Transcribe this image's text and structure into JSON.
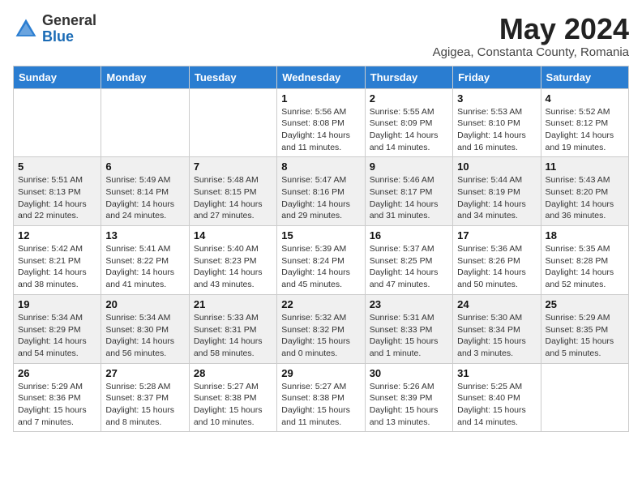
{
  "header": {
    "logo_general": "General",
    "logo_blue": "Blue",
    "month_title": "May 2024",
    "subtitle": "Agigea, Constanta County, Romania"
  },
  "weekdays": [
    "Sunday",
    "Monday",
    "Tuesday",
    "Wednesday",
    "Thursday",
    "Friday",
    "Saturday"
  ],
  "weeks": [
    [
      {
        "day": "",
        "sunrise": "",
        "sunset": "",
        "daylight": ""
      },
      {
        "day": "",
        "sunrise": "",
        "sunset": "",
        "daylight": ""
      },
      {
        "day": "",
        "sunrise": "",
        "sunset": "",
        "daylight": ""
      },
      {
        "day": "1",
        "sunrise": "Sunrise: 5:56 AM",
        "sunset": "Sunset: 8:08 PM",
        "daylight": "Daylight: 14 hours and 11 minutes."
      },
      {
        "day": "2",
        "sunrise": "Sunrise: 5:55 AM",
        "sunset": "Sunset: 8:09 PM",
        "daylight": "Daylight: 14 hours and 14 minutes."
      },
      {
        "day": "3",
        "sunrise": "Sunrise: 5:53 AM",
        "sunset": "Sunset: 8:10 PM",
        "daylight": "Daylight: 14 hours and 16 minutes."
      },
      {
        "day": "4",
        "sunrise": "Sunrise: 5:52 AM",
        "sunset": "Sunset: 8:12 PM",
        "daylight": "Daylight: 14 hours and 19 minutes."
      }
    ],
    [
      {
        "day": "5",
        "sunrise": "Sunrise: 5:51 AM",
        "sunset": "Sunset: 8:13 PM",
        "daylight": "Daylight: 14 hours and 22 minutes."
      },
      {
        "day": "6",
        "sunrise": "Sunrise: 5:49 AM",
        "sunset": "Sunset: 8:14 PM",
        "daylight": "Daylight: 14 hours and 24 minutes."
      },
      {
        "day": "7",
        "sunrise": "Sunrise: 5:48 AM",
        "sunset": "Sunset: 8:15 PM",
        "daylight": "Daylight: 14 hours and 27 minutes."
      },
      {
        "day": "8",
        "sunrise": "Sunrise: 5:47 AM",
        "sunset": "Sunset: 8:16 PM",
        "daylight": "Daylight: 14 hours and 29 minutes."
      },
      {
        "day": "9",
        "sunrise": "Sunrise: 5:46 AM",
        "sunset": "Sunset: 8:17 PM",
        "daylight": "Daylight: 14 hours and 31 minutes."
      },
      {
        "day": "10",
        "sunrise": "Sunrise: 5:44 AM",
        "sunset": "Sunset: 8:19 PM",
        "daylight": "Daylight: 14 hours and 34 minutes."
      },
      {
        "day": "11",
        "sunrise": "Sunrise: 5:43 AM",
        "sunset": "Sunset: 8:20 PM",
        "daylight": "Daylight: 14 hours and 36 minutes."
      }
    ],
    [
      {
        "day": "12",
        "sunrise": "Sunrise: 5:42 AM",
        "sunset": "Sunset: 8:21 PM",
        "daylight": "Daylight: 14 hours and 38 minutes."
      },
      {
        "day": "13",
        "sunrise": "Sunrise: 5:41 AM",
        "sunset": "Sunset: 8:22 PM",
        "daylight": "Daylight: 14 hours and 41 minutes."
      },
      {
        "day": "14",
        "sunrise": "Sunrise: 5:40 AM",
        "sunset": "Sunset: 8:23 PM",
        "daylight": "Daylight: 14 hours and 43 minutes."
      },
      {
        "day": "15",
        "sunrise": "Sunrise: 5:39 AM",
        "sunset": "Sunset: 8:24 PM",
        "daylight": "Daylight: 14 hours and 45 minutes."
      },
      {
        "day": "16",
        "sunrise": "Sunrise: 5:37 AM",
        "sunset": "Sunset: 8:25 PM",
        "daylight": "Daylight: 14 hours and 47 minutes."
      },
      {
        "day": "17",
        "sunrise": "Sunrise: 5:36 AM",
        "sunset": "Sunset: 8:26 PM",
        "daylight": "Daylight: 14 hours and 50 minutes."
      },
      {
        "day": "18",
        "sunrise": "Sunrise: 5:35 AM",
        "sunset": "Sunset: 8:28 PM",
        "daylight": "Daylight: 14 hours and 52 minutes."
      }
    ],
    [
      {
        "day": "19",
        "sunrise": "Sunrise: 5:34 AM",
        "sunset": "Sunset: 8:29 PM",
        "daylight": "Daylight: 14 hours and 54 minutes."
      },
      {
        "day": "20",
        "sunrise": "Sunrise: 5:34 AM",
        "sunset": "Sunset: 8:30 PM",
        "daylight": "Daylight: 14 hours and 56 minutes."
      },
      {
        "day": "21",
        "sunrise": "Sunrise: 5:33 AM",
        "sunset": "Sunset: 8:31 PM",
        "daylight": "Daylight: 14 hours and 58 minutes."
      },
      {
        "day": "22",
        "sunrise": "Sunrise: 5:32 AM",
        "sunset": "Sunset: 8:32 PM",
        "daylight": "Daylight: 15 hours and 0 minutes."
      },
      {
        "day": "23",
        "sunrise": "Sunrise: 5:31 AM",
        "sunset": "Sunset: 8:33 PM",
        "daylight": "Daylight: 15 hours and 1 minute."
      },
      {
        "day": "24",
        "sunrise": "Sunrise: 5:30 AM",
        "sunset": "Sunset: 8:34 PM",
        "daylight": "Daylight: 15 hours and 3 minutes."
      },
      {
        "day": "25",
        "sunrise": "Sunrise: 5:29 AM",
        "sunset": "Sunset: 8:35 PM",
        "daylight": "Daylight: 15 hours and 5 minutes."
      }
    ],
    [
      {
        "day": "26",
        "sunrise": "Sunrise: 5:29 AM",
        "sunset": "Sunset: 8:36 PM",
        "daylight": "Daylight: 15 hours and 7 minutes."
      },
      {
        "day": "27",
        "sunrise": "Sunrise: 5:28 AM",
        "sunset": "Sunset: 8:37 PM",
        "daylight": "Daylight: 15 hours and 8 minutes."
      },
      {
        "day": "28",
        "sunrise": "Sunrise: 5:27 AM",
        "sunset": "Sunset: 8:38 PM",
        "daylight": "Daylight: 15 hours and 10 minutes."
      },
      {
        "day": "29",
        "sunrise": "Sunrise: 5:27 AM",
        "sunset": "Sunset: 8:38 PM",
        "daylight": "Daylight: 15 hours and 11 minutes."
      },
      {
        "day": "30",
        "sunrise": "Sunrise: 5:26 AM",
        "sunset": "Sunset: 8:39 PM",
        "daylight": "Daylight: 15 hours and 13 minutes."
      },
      {
        "day": "31",
        "sunrise": "Sunrise: 5:25 AM",
        "sunset": "Sunset: 8:40 PM",
        "daylight": "Daylight: 15 hours and 14 minutes."
      },
      {
        "day": "",
        "sunrise": "",
        "sunset": "",
        "daylight": ""
      }
    ]
  ]
}
